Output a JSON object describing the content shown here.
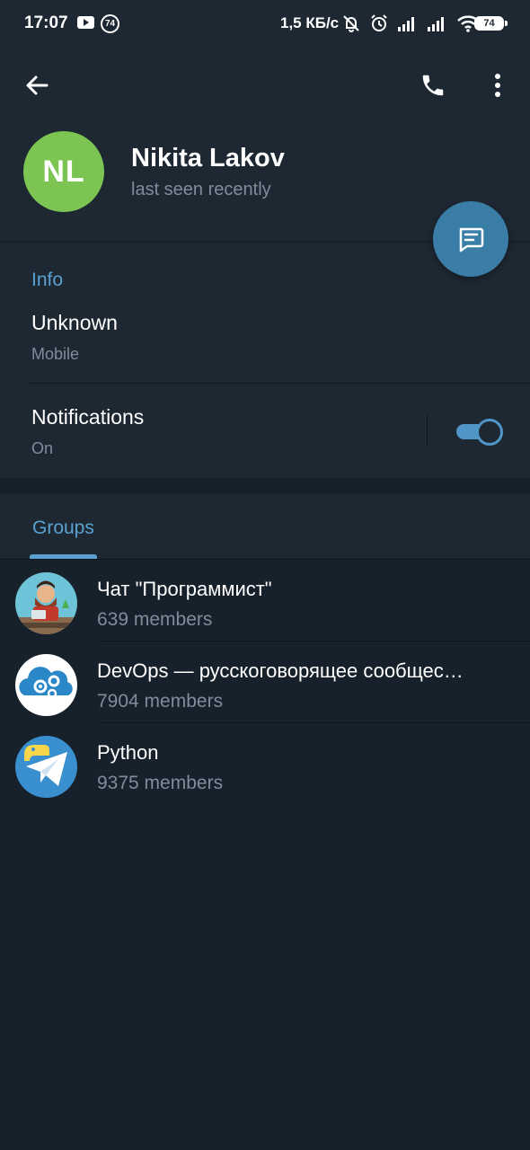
{
  "status_bar": {
    "time": "17:07",
    "notification_count": "74",
    "network_speed": "1,5 КБ/с",
    "battery": "74"
  },
  "header": {
    "name": "Nikita Lakov",
    "status": "last seen recently",
    "avatar_initials": "NL",
    "avatar_color": "#7cc552"
  },
  "info": {
    "section_title": "Info",
    "phone_value": "Unknown",
    "phone_label": "Mobile",
    "notifications_label": "Notifications",
    "notifications_state": "On"
  },
  "groups": {
    "tab_label": "Groups",
    "items": [
      {
        "name": "Чат \"Программист\"",
        "members": "639 members",
        "icon": "programmer-avatar"
      },
      {
        "name": "DevOps — русскоговорящее сообщес…",
        "members": "7904 members",
        "icon": "devops-cloud-avatar"
      },
      {
        "name": "Python",
        "members": "9375 members",
        "icon": "python-telegram-avatar"
      }
    ]
  },
  "colors": {
    "background": "#17212b",
    "surface": "#1e2833",
    "accent": "#5aa1d1",
    "fab": "#3a7ea8",
    "secondary_text": "#7f8d9b"
  }
}
